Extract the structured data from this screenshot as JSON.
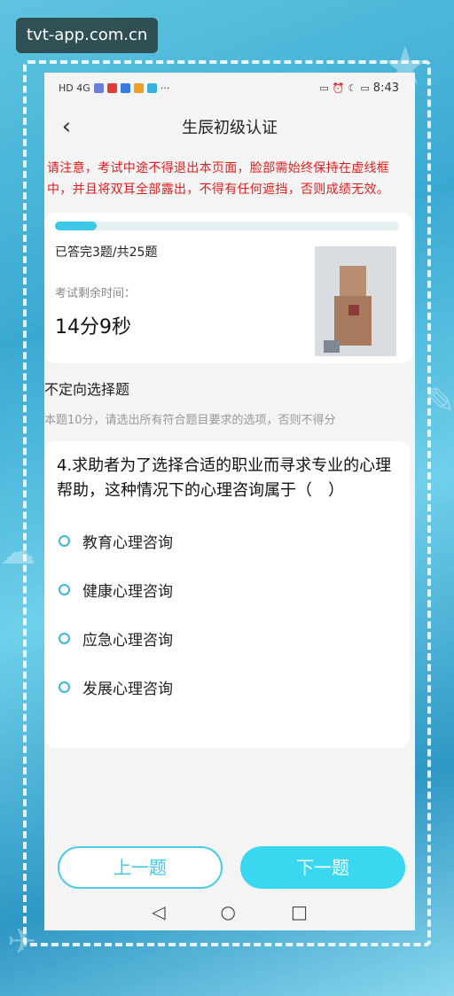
{
  "watermark": "tvt-app.com.cn",
  "statusbar": {
    "time": "8:43",
    "left_text": "HD 4G",
    "dots": "···"
  },
  "header": {
    "back_icon": "chevron-left-icon",
    "title": "生辰初级认证"
  },
  "warning": "请注意，考试中途不得退出本页面，脸部需始终保持在虚线框中，并且将双耳全部露出，不得有任何遮挡，否则成绩无效。",
  "exam": {
    "progress_fraction": 0.12,
    "answered_text": "已答完3题/共25题",
    "remain_label": "考试剩余时间：",
    "remain_time": "14分9秒"
  },
  "question": {
    "type": "不定向选择题",
    "desc": "本题10分，请选出所有符合题目要求的选项，否则不得分",
    "text": "4.求助者为了选择合适的职业而寻求专业的心理帮助，这种情况下的心理咨询属于（　）",
    "options": [
      "教育心理咨询",
      "健康心理咨询",
      "应急心理咨询",
      "发展心理咨询"
    ]
  },
  "buttons": {
    "prev": "上一题",
    "next": "下一题"
  },
  "colors": {
    "accent": "#3cc8e8",
    "warning": "#e01e1e"
  }
}
